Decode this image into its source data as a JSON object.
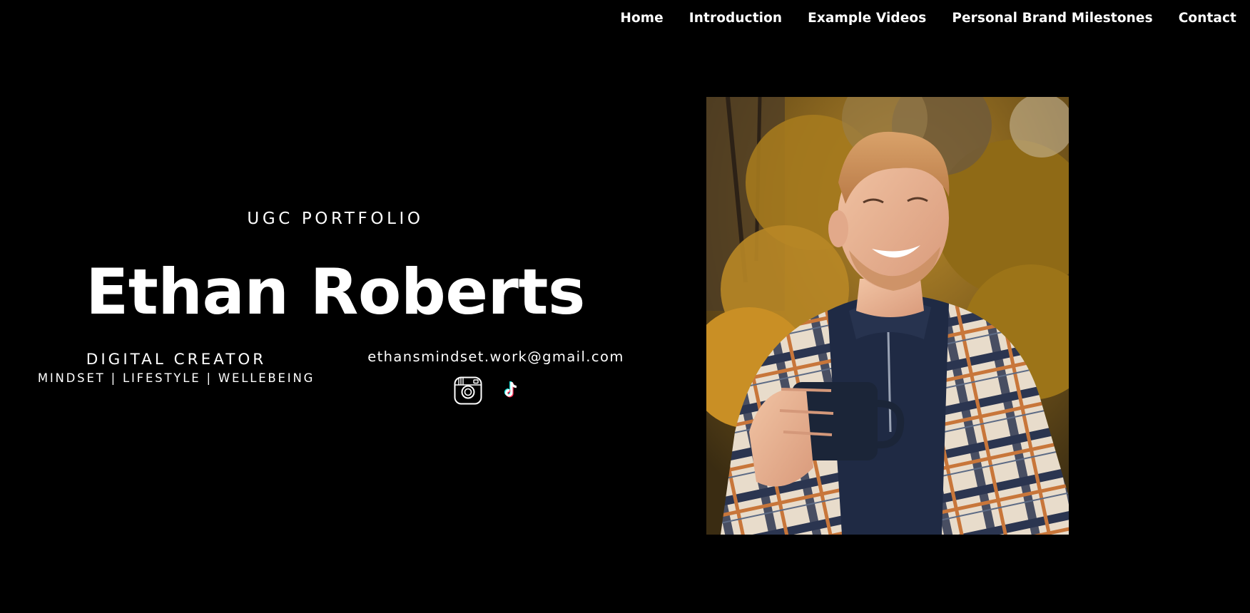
{
  "nav": {
    "items": [
      {
        "label": "Home"
      },
      {
        "label": "Introduction"
      },
      {
        "label": "Example Videos"
      },
      {
        "label": "Personal Brand Milestones"
      },
      {
        "label": "Contact"
      }
    ]
  },
  "hero": {
    "eyebrow": "UGC PORTFOLIO",
    "name": "Ethan Roberts",
    "role": "DIGITAL CREATOR",
    "tags": "MINDSET | LIFESTYLE | WELLEBEING",
    "email": "ethansmindset.work@gmail.com"
  },
  "social": {
    "icons": [
      "instagram-icon",
      "tiktok-icon"
    ]
  },
  "photo": {
    "subject": "portrait-photo"
  },
  "colors": {
    "background": "#000000",
    "text": "#ffffff",
    "tiktok_cyan": "#25F4EE",
    "tiktok_red": "#FE2C55"
  }
}
